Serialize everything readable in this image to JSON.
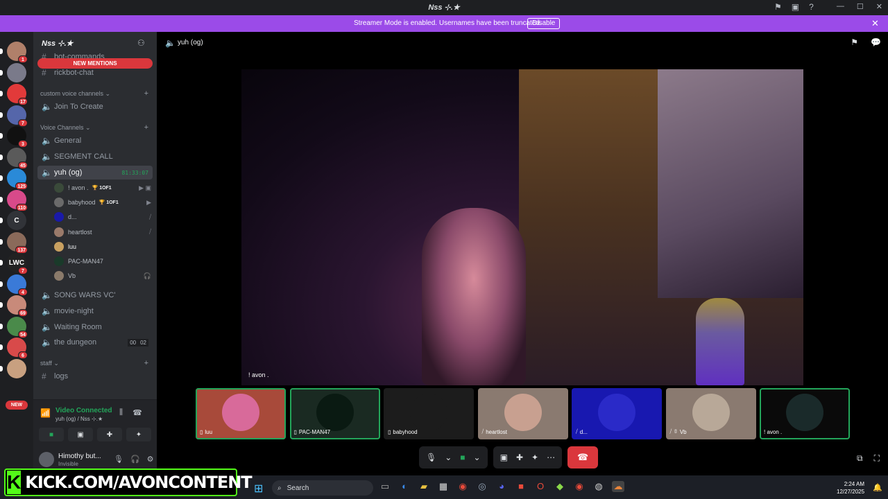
{
  "window": {
    "title": "Nss ⊹.★"
  },
  "banner": {
    "text": "Streamer Mode is enabled. Usernames have been truncated.",
    "button": "Disable"
  },
  "guilds": [
    {
      "icon": "avatar-icon",
      "badge": "1",
      "color": "#b0806a"
    },
    {
      "icon": "avatar-icon",
      "badge": "",
      "color": "#7a7a8a"
    },
    {
      "icon": "avatar-icon",
      "badge": "17",
      "color": "#e23a3a"
    },
    {
      "icon": "avatar-icon",
      "badge": "7",
      "color": "#5566aa"
    },
    {
      "icon": "avatar-icon",
      "badge": "3",
      "color": "#111111"
    },
    {
      "icon": "avatar-icon",
      "badge": "45",
      "color": "#5a5a5a"
    },
    {
      "icon": "avatar-icon",
      "badge": "125",
      "color": "#2a8ad8"
    },
    {
      "icon": "avatar-icon",
      "badge": "110",
      "color": "#d84a8a"
    },
    {
      "icon": "letter-icon",
      "label": "C",
      "badge": "",
      "color": "#313338"
    },
    {
      "icon": "avatar-icon",
      "badge": "137",
      "color": "#8a6a5a"
    },
    {
      "icon": "avatar-icon",
      "label": "LWC",
      "badge": "7",
      "color": "#222222"
    },
    {
      "icon": "avatar-icon",
      "badge": "4",
      "color": "#3a7ad8"
    },
    {
      "icon": "avatar-icon",
      "badge": "69",
      "color": "#c88a7a"
    },
    {
      "icon": "avatar-icon",
      "badge": "54",
      "color": "#4a8a4a"
    },
    {
      "icon": "avatar-icon",
      "badge": "6",
      "color": "#d84a4a"
    },
    {
      "icon": "avatar-icon",
      "badge": "",
      "color": "#c8a080"
    }
  ],
  "new_badge": "NEW",
  "server": {
    "name": "Nss ⊹.★",
    "new_mentions": "NEW MENTIONS"
  },
  "channels": {
    "bot_commands": "bot-commands",
    "rickbot": "rickbot-chat",
    "cat_custom": "custom voice channels",
    "join_to_create": "Join To Create",
    "cat_voice": "Voice Channels",
    "general": "General",
    "segment": "SEGMENT CALL",
    "yuh": "yuh (og)",
    "yuh_timer": "81:33:07",
    "song_wars": "SONG WARS VC'",
    "movie_night": "movie-night",
    "waiting": "Waiting Room",
    "dungeon": "the dungeon",
    "dungeon_count_a": "00",
    "dungeon_count_b": "02",
    "cat_staff": "staff",
    "logs": "logs"
  },
  "members": [
    {
      "name": "! avon .",
      "tag": "🏆 1OF1",
      "color": "#3a4a3a",
      "right": "▶ ▣"
    },
    {
      "name": "babyhood",
      "tag": "🏆 1OF1",
      "color": "#6a6a6a",
      "right": "▶"
    },
    {
      "name": "d...",
      "tag": "",
      "color": "#1a1aa8",
      "right": "⧸"
    },
    {
      "name": "heartlost",
      "tag": "",
      "color": "#9a7a6a",
      "right": "⧸"
    },
    {
      "name": "luu",
      "tag": "",
      "color": "#c8a060",
      "right": ""
    },
    {
      "name": "PAC-MAN47",
      "tag": "",
      "color": "#1a3a2a",
      "right": ""
    },
    {
      "name": "Vb",
      "tag": "",
      "color": "#8a7a6a",
      "right": "🎧"
    }
  ],
  "voice_panel": {
    "status": "Video Connected",
    "sub": "yuh (og) / Nss ⊹.★"
  },
  "user": {
    "name": "Himothy but...",
    "status": "Invisible"
  },
  "main": {
    "channel": "yuh (og)",
    "stage_label": "! avon ."
  },
  "tiles": [
    {
      "name": "luu",
      "prefix": "▯",
      "bg": "#a84a3a",
      "av": "#d86a9a",
      "speaking": true
    },
    {
      "name": "PAC-MAN47",
      "prefix": "▯",
      "bg": "#1a2a22",
      "av": "#0a1a12",
      "speaking": true
    },
    {
      "name": "babyhood",
      "prefix": "▯",
      "bg": "#1c1c1c",
      "av": "#1c1c1c",
      "speaking": false
    },
    {
      "name": "heartlost",
      "prefix": "⧸",
      "bg": "#8a7a70",
      "av": "#c8a090",
      "speaking": false
    },
    {
      "name": "d...",
      "prefix": "⧸",
      "bg": "#1818b0",
      "av": "#2a2ac8",
      "speaking": false
    },
    {
      "name": "Vb",
      "prefix": "⧸ ▯",
      "bg": "#8a7a70",
      "av": "#b8a898",
      "speaking": false
    },
    {
      "name": "! avon .",
      "prefix": "",
      "bg": "#0a0a0a",
      "av": "#1a2a2a",
      "speaking": true
    }
  ],
  "overlay": {
    "url": "KICK.COM/AVONCONTENT"
  },
  "taskbar": {
    "search": "Search",
    "time": "2:24 AM",
    "date": "12/27/2025"
  },
  "colors": {
    "accent": "#9b4be8",
    "green": "#23a55a",
    "red": "#da373c",
    "kick": "#53fc18"
  }
}
